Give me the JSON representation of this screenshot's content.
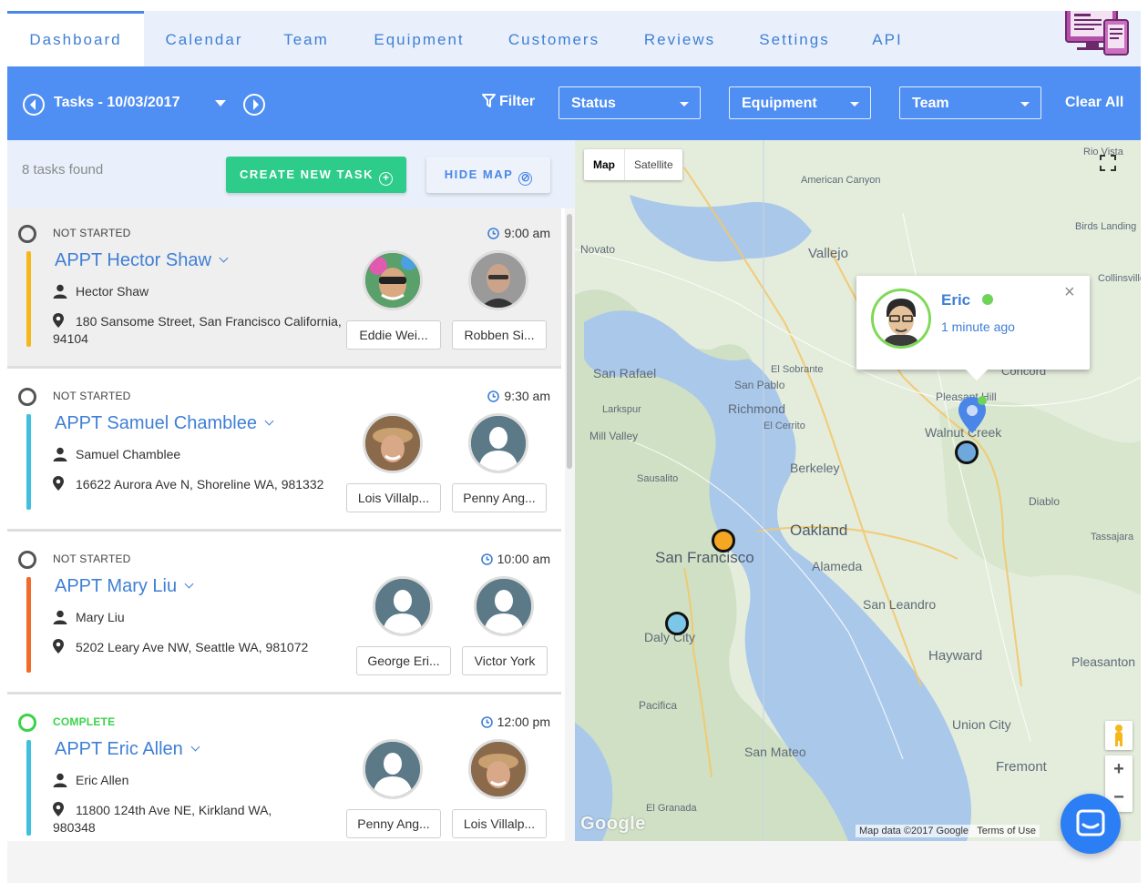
{
  "nav": {
    "tabs": [
      {
        "label": "Dashboard",
        "active": true
      },
      {
        "label": "Calendar"
      },
      {
        "label": "Team"
      },
      {
        "label": "Equipment"
      },
      {
        "label": "Customers"
      },
      {
        "label": "Reviews"
      },
      {
        "label": "Settings"
      },
      {
        "label": "API"
      }
    ],
    "brand_icon": "devices-icon"
  },
  "toolbar": {
    "prev_icon": "chevron-left-circle-icon",
    "date_label": "Tasks - 10/03/2017",
    "next_icon": "chevron-right-circle-icon",
    "filter_label": "Filter",
    "filters": [
      {
        "label": "Status"
      },
      {
        "label": "Equipment"
      },
      {
        "label": "Team"
      }
    ],
    "clear_all": "Clear All",
    "bg_color": "#4f8ef2"
  },
  "list": {
    "tasks_found": "8 tasks found",
    "create_label": "CREATE NEW TASK",
    "hide_map_label": "HIDE MAP",
    "tasks": [
      {
        "status": "NOT STARTED",
        "time": "9:00 am",
        "title": "APPT Hector Shaw",
        "customer": "Hector Shaw",
        "address_line1": "180 Sansome Street, San Francisco California,",
        "address_line2": "94104",
        "bar_color": "#f5b81b",
        "assignees": [
          "Eddie Wei...",
          "Robben Si..."
        ]
      },
      {
        "status": "NOT STARTED",
        "time": "9:30 am",
        "title": "APPT Samuel Chamblee",
        "customer": "Samuel Chamblee",
        "address_line1": "16622 Aurora Ave N, Shoreline WA, 981332",
        "address_line2": "",
        "bar_color": "#3fc0de",
        "assignees": [
          "Lois Villalp...",
          "Penny Ang..."
        ]
      },
      {
        "status": "NOT STARTED",
        "time": "10:00 am",
        "title": "APPT Mary Liu",
        "customer": "Mary Liu",
        "address_line1": "5202 Leary Ave NW, Seattle WA, 981072",
        "address_line2": "",
        "bar_color": "#f26b2a",
        "assignees": [
          "George Eri...",
          "Victor York"
        ]
      },
      {
        "status": "COMPLETE",
        "time": "12:00 pm",
        "title": "APPT Eric Allen",
        "customer": "Eric Allen",
        "address_line1": "11800 124th Ave NE, Kirkland WA,",
        "address_line2": "980348",
        "bar_color": "#3fc0de",
        "assignees": [
          "Penny Ang...",
          "Lois Villalp..."
        ]
      }
    ]
  },
  "map": {
    "type_map": "Map",
    "type_satellite": "Satellite",
    "labels": {
      "san_francisco": "San Francisco",
      "oakland": "Oakland",
      "berkeley": "Berkeley",
      "richmond": "Richmond",
      "vallejo": "Vallejo",
      "san_rafael": "San Rafael",
      "novato": "Novato",
      "daly_city": "Daly City",
      "san_mateo": "San Mateo",
      "hayward": "Hayward",
      "fremont": "Fremont",
      "alameda": "Alameda",
      "san_leandro": "San Leandro",
      "union_city": "Union City",
      "pleasanton": "Pleasanton",
      "walnut_creek": "Walnut Creek",
      "diablo": "Diablo",
      "pacifica": "Pacifica",
      "sausalito": "Sausalito",
      "mill_valley": "Mill Valley",
      "larkspur": "Larkspur",
      "el_cerrito": "El Cerrito",
      "san_pablo": "San Pablo",
      "el_sobrante": "El Sobrante",
      "american_canyon": "American Canyon",
      "birds_landing": "Birds Landing",
      "tassajara": "Tassajara",
      "el_granada": "El Granada",
      "concord": "Concord",
      "pleasant_hill": "Pleasant Hill",
      "collinsville": "Collinsville",
      "rio_vista": "Rio Vista"
    },
    "popup": {
      "name": "Eric",
      "time": "1 minute ago",
      "close": "×"
    },
    "attribution": "Map data ©2017 Google",
    "terms": "Terms of Use",
    "google": "Google",
    "zoom_in": "+",
    "zoom_out": "−",
    "marker_colors": [
      "#f5a623",
      "#7cc7e8",
      "#6fa8dc"
    ]
  }
}
